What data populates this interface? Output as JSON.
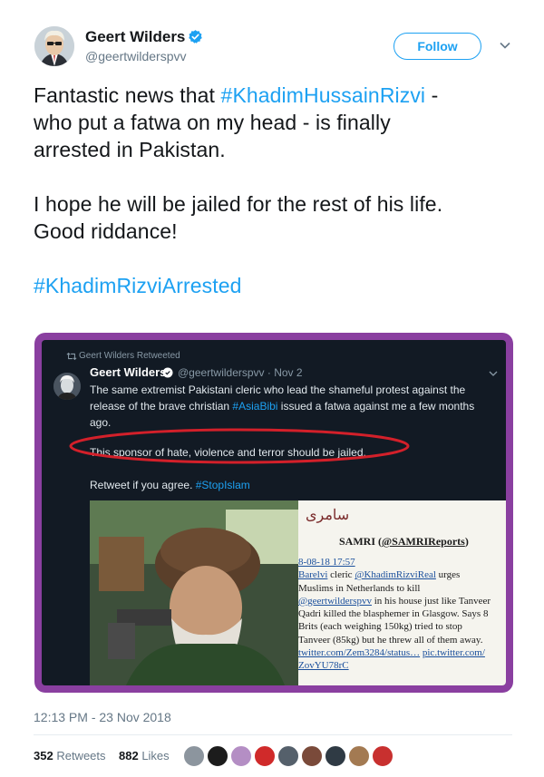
{
  "header": {
    "name": "Geert Wilders",
    "handle": "@geertwilderspvv",
    "follow_label": "Follow"
  },
  "tweet": {
    "line1_pre": "Fantastic news that ",
    "line1_tag": "#KhadimHussainRizvi",
    "line1_post": " -",
    "line2": "who put a fatwa on my head - is finally",
    "line3": "arrested in Pakistan.",
    "line4": "I hope he will be jailed for the rest of his life.",
    "line5": "Good riddance!",
    "hashtag": "#KhadimRizviArrested"
  },
  "media": {
    "retweeted_by": "Geert Wilders Retweeted",
    "name": "Geert Wilders",
    "handle_date": "@geertwilderspvv · Nov 2",
    "text1": "The same extremist Pakistani cleric who lead the shameful protest against the",
    "text2_pre": "release of the brave christian ",
    "text2_tag": "#AsiaBibi",
    "text2_post": " issued a fatwa against me a few months",
    "text3": "ago.",
    "sponsor": "This sponsor of hate, violence and terror should be jailed.",
    "retweet_pre": "Retweet if you agree. ",
    "retweet_tag": "#StopIslam",
    "samri": {
      "urdu": "سامری",
      "title_pre": "SAMRI (",
      "title_link": "@SAMRIReports",
      "title_post": ")",
      "date": "8-08-18 17:57",
      "l1_link": "Barelvi",
      "l1_mid": " cleric ",
      "l1_link2": "@KhadimRizviReal",
      "l1_post": " urges",
      "l2": "Muslims in Netherlands to kill",
      "l3_link": "@geertwilderspvv",
      "l3_post": " in his house just like Tanveer",
      "l4": "Qadri killed the blasphemer in Glasgow. Says 8",
      "l5": "Brits (each weighing 150kg) tried to stop",
      "l6": "Tanveer (85kg) but he threw all of them away.",
      "l7_link": "twitter.com/Zem3284/status…",
      "l7_link2": "pic.twitter.com/",
      "l8_link": "ZovYU78rC"
    }
  },
  "footer": {
    "timestamp": "12:13 PM - 23 Nov 2018",
    "retweets_count": "352",
    "retweets_label": "Retweets",
    "likes_count": "882",
    "likes_label": "Likes"
  },
  "colors": {
    "accent": "#1da1f2",
    "media_frame": "#8a3fa0",
    "ellipse": "#d3202a"
  },
  "icons": [
    "verified-badge-icon",
    "chevron-down-icon",
    "retweet-icon"
  ]
}
